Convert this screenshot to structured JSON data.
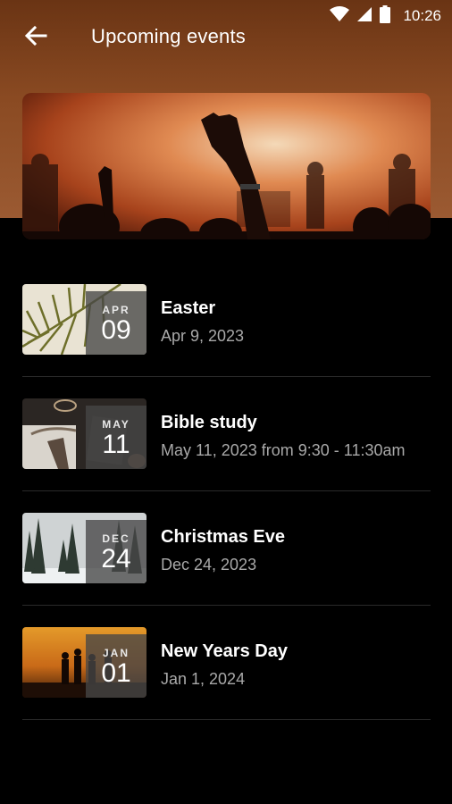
{
  "status_bar": {
    "time": "10:26",
    "icons": [
      "wifi-icon",
      "signal-icon",
      "battery-icon"
    ]
  },
  "app_bar": {
    "title": "Upcoming events",
    "back_icon": "arrow-left-icon"
  },
  "hero": {
    "image": "concert-crowd-raised-hands"
  },
  "events": [
    {
      "title": "Easter",
      "date": "Apr 9, 2023",
      "badge_month": "APR",
      "badge_day": "09",
      "image": "palm-leaf"
    },
    {
      "title": "Bible study",
      "date": "May 11, 2023 from 9:30 - 11:30am",
      "badge_month": "MAY",
      "badge_day": "11",
      "image": "bible-study-table"
    },
    {
      "title": "Christmas Eve",
      "date": "Dec 24, 2023",
      "badge_month": "DEC",
      "badge_day": "24",
      "image": "snowy-forest"
    },
    {
      "title": "New Years Day",
      "date": "Jan 1, 2024",
      "badge_month": "JAN",
      "badge_day": "01",
      "image": "sunset-silhouettes"
    }
  ],
  "colors": {
    "header_background": "#8a4a22",
    "background": "#000000",
    "secondary_text": "#a9a9a9",
    "divider": "#2a2a2a"
  }
}
